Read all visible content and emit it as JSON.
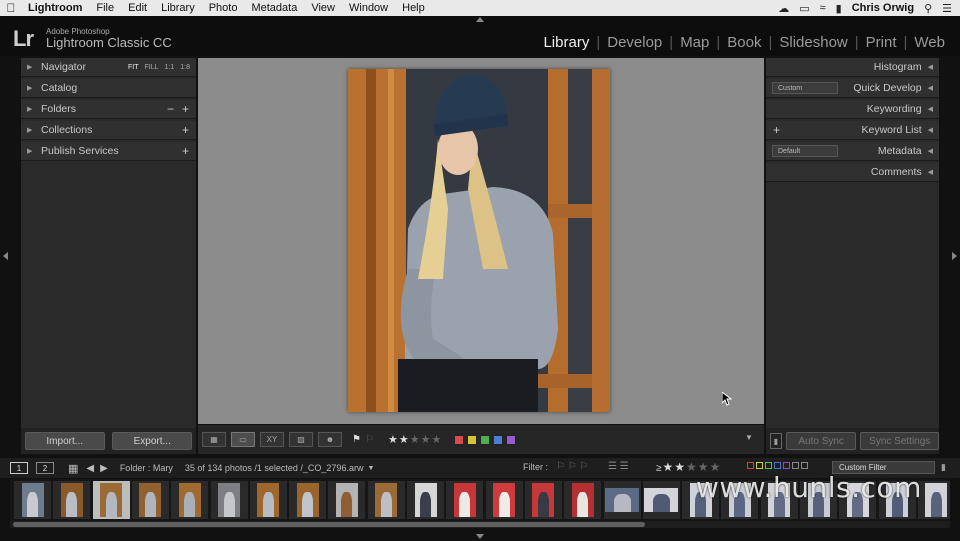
{
  "menubar": {
    "app": "Lightroom",
    "items": [
      "File",
      "Edit",
      "Library",
      "Photo",
      "Metadata",
      "View",
      "Window",
      "Help"
    ],
    "user": "Chris Orwig"
  },
  "identity": {
    "small": "Adobe Photoshop",
    "big": "Lightroom Classic CC",
    "logo": "Lr"
  },
  "modules": [
    "Library",
    "Develop",
    "Map",
    "Book",
    "Slideshow",
    "Print",
    "Web"
  ],
  "left_panel": {
    "navigator": {
      "label": "Navigator",
      "zoom": [
        "FIT",
        "FILL",
        "1:1",
        "1:8"
      ]
    },
    "catalog": "Catalog",
    "folders": "Folders",
    "collections": "Collections",
    "publish": "Publish Services",
    "import_label": "Import...",
    "export_label": "Export..."
  },
  "right_panel": {
    "histogram": "Histogram",
    "quick_develop": "Quick Develop",
    "quick_preset": "Custom",
    "keywording": "Keywording",
    "keyword_list": "Keyword List",
    "metadata": "Metadata",
    "metadata_preset": "Default",
    "comments": "Comments",
    "auto_sync": "Auto Sync",
    "sync_settings": "Sync Settings"
  },
  "toolbar": {
    "rating": 2,
    "rating_max": 5,
    "color_labels": [
      "#d84b4b",
      "#d8c23c",
      "#4cb04c",
      "#4a7fd6",
      "#9a5ad0"
    ]
  },
  "filmstrip": {
    "page1": "1",
    "page2": "2",
    "folder": "Folder : Mary",
    "count": "35 of 134 photos /1 selected /_CO_2796.arw",
    "filter_label": "Filter :",
    "custom_filter": "Custom Filter",
    "filter_rating": 2,
    "selected_index": 2,
    "thumbs": [
      {
        "bg": "#6d7d8d",
        "fg": "#c9c9cf"
      },
      {
        "bg": "#8a5a2a",
        "fg": "#b9bdc5"
      },
      {
        "bg": "#9b6a34",
        "fg": "#b3b8c0"
      },
      {
        "bg": "#93612f",
        "fg": "#b0b5bd"
      },
      {
        "bg": "#a06a30",
        "fg": "#aab0b8"
      },
      {
        "bg": "#7d7f82",
        "fg": "#c5c7cb"
      },
      {
        "bg": "#a0672c",
        "fg": "#b7bcc4"
      },
      {
        "bg": "#9a642d",
        "fg": "#c0c4ca"
      },
      {
        "bg": "#b3b3b3",
        "fg": "#8f5e34"
      },
      {
        "bg": "#9c6a36",
        "fg": "#bdbfc4"
      },
      {
        "bg": "#d6d6d6",
        "fg": "#3a3f4a"
      },
      {
        "bg": "#c9363a",
        "fg": "#ede9e5"
      },
      {
        "bg": "#cf3a3c",
        "fg": "#efebe6"
      },
      {
        "bg": "#c7383a",
        "fg": "#3a3a44"
      },
      {
        "bg": "#b53033",
        "fg": "#e9e5e1"
      },
      {
        "bg": "#5b6a85",
        "fg": "#b6b9c2"
      },
      {
        "bg": "#d3d5da",
        "fg": "#4f5a75"
      },
      {
        "bg": "#cfd2d8",
        "fg": "#56607a"
      },
      {
        "bg": "#cbcdd3",
        "fg": "#5b6684"
      },
      {
        "bg": "#d0d2d7",
        "fg": "#636b86"
      },
      {
        "bg": "#c8cbd2",
        "fg": "#59607c"
      },
      {
        "bg": "#d5d7dc",
        "fg": "#636b85"
      },
      {
        "bg": "#cdd0d6",
        "fg": "#535c78"
      },
      {
        "bg": "#d1d3d9",
        "fg": "#59627d"
      }
    ]
  },
  "watermark": "www.hunls.com"
}
